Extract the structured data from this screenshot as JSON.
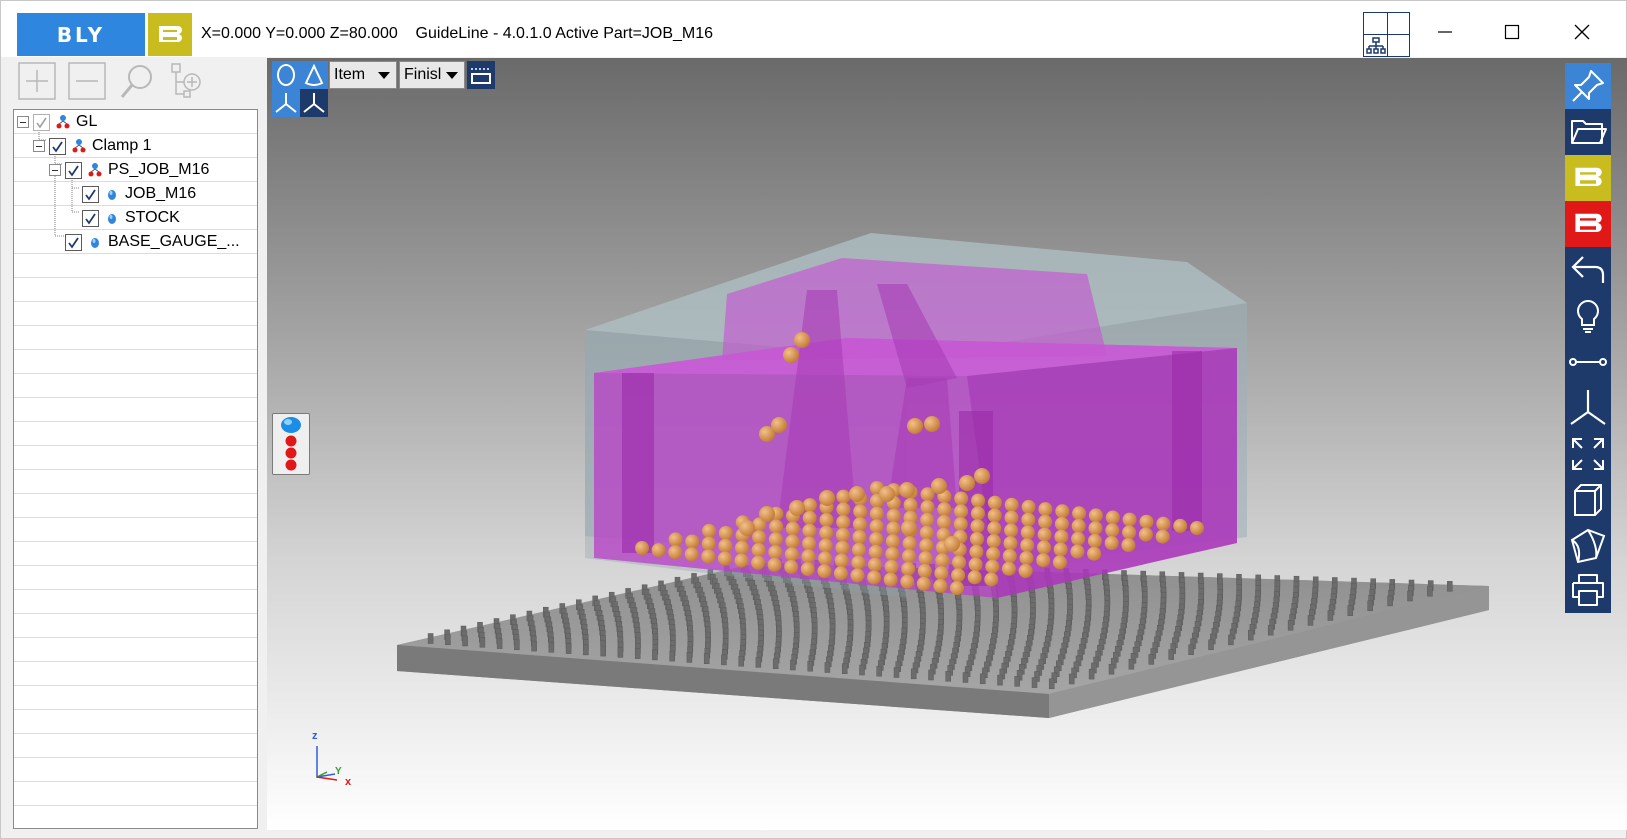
{
  "titlebar": {
    "logo_text": "BLY",
    "title": "X=0.000 Y=0.000 Z=80.000    GuideLine - 4.0.1.0 Active Part=JOB_M16",
    "icons": [
      "bly-logo",
      "b-logo",
      "layout-icon",
      "minimize-icon",
      "maximize-icon",
      "close-icon"
    ]
  },
  "left_toolbar": {
    "icons": [
      "add-icon",
      "remove-icon",
      "search-icon",
      "add-node-icon"
    ]
  },
  "tree": {
    "nodes": [
      {
        "label": "GL",
        "checked": true,
        "expander": true,
        "icon": "assembly-icon"
      },
      {
        "label": "Clamp 1",
        "checked": true,
        "expander": true,
        "icon": "assembly-icon"
      },
      {
        "label": "PS_JOB_M16",
        "checked": true,
        "expander": true,
        "icon": "assembly-icon"
      },
      {
        "label": "JOB_M16",
        "checked": true,
        "expander": false,
        "icon": "part-icon"
      },
      {
        "label": "STOCK",
        "checked": true,
        "expander": false,
        "icon": "part-icon"
      },
      {
        "label": "BASE_GAUGE_...",
        "checked": true,
        "expander": false,
        "icon": "part-icon"
      }
    ]
  },
  "viewport_toolbar": {
    "item_select": "Item",
    "finish_select": "Finisl",
    "icons": [
      "shade-icon",
      "cone-icon",
      "plane-icon",
      "axis-view-icon",
      "axis-view-alt-icon"
    ]
  },
  "axis_triad": {
    "z": "z",
    "y": "Y",
    "x": "x"
  },
  "right_toolbar": {
    "icons": [
      "pin-icon",
      "folder-icon",
      "b-yellow-icon",
      "b-red-icon",
      "undo-icon",
      "lightbulb-icon",
      "measure-icon",
      "axis-icon",
      "expand-icon",
      "box-icon",
      "section-icon",
      "print-icon"
    ]
  },
  "colors": {
    "accent_blue": "#2f86de",
    "brand_yellow": "#c9bc1e",
    "brand_red": "#e01818",
    "toolbar_navy": "#1d3a6b",
    "part_magenta": "#b93ec8",
    "sphere_orange": "#d9954a"
  }
}
